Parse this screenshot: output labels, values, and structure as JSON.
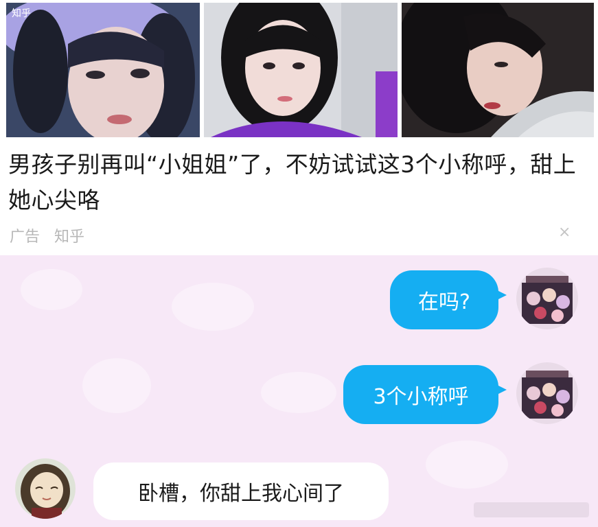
{
  "ad": {
    "title": "男孩子别再叫“小姐姐”了，不妨试试这3个小称呼，甜上她心尖咯",
    "tag": "广告",
    "source": "知乎",
    "close": "×",
    "image_watermark": "知乎"
  },
  "chat": {
    "messages": [
      {
        "side": "out",
        "text": "在吗?"
      },
      {
        "side": "out",
        "text": "3个小称呼"
      },
      {
        "side": "in",
        "text": "卧槽，你甜上我心间了"
      }
    ]
  },
  "colors": {
    "chat_background": "#f7e8f7",
    "outgoing_bubble": "#15aef2",
    "incoming_bubble": "#ffffff"
  }
}
